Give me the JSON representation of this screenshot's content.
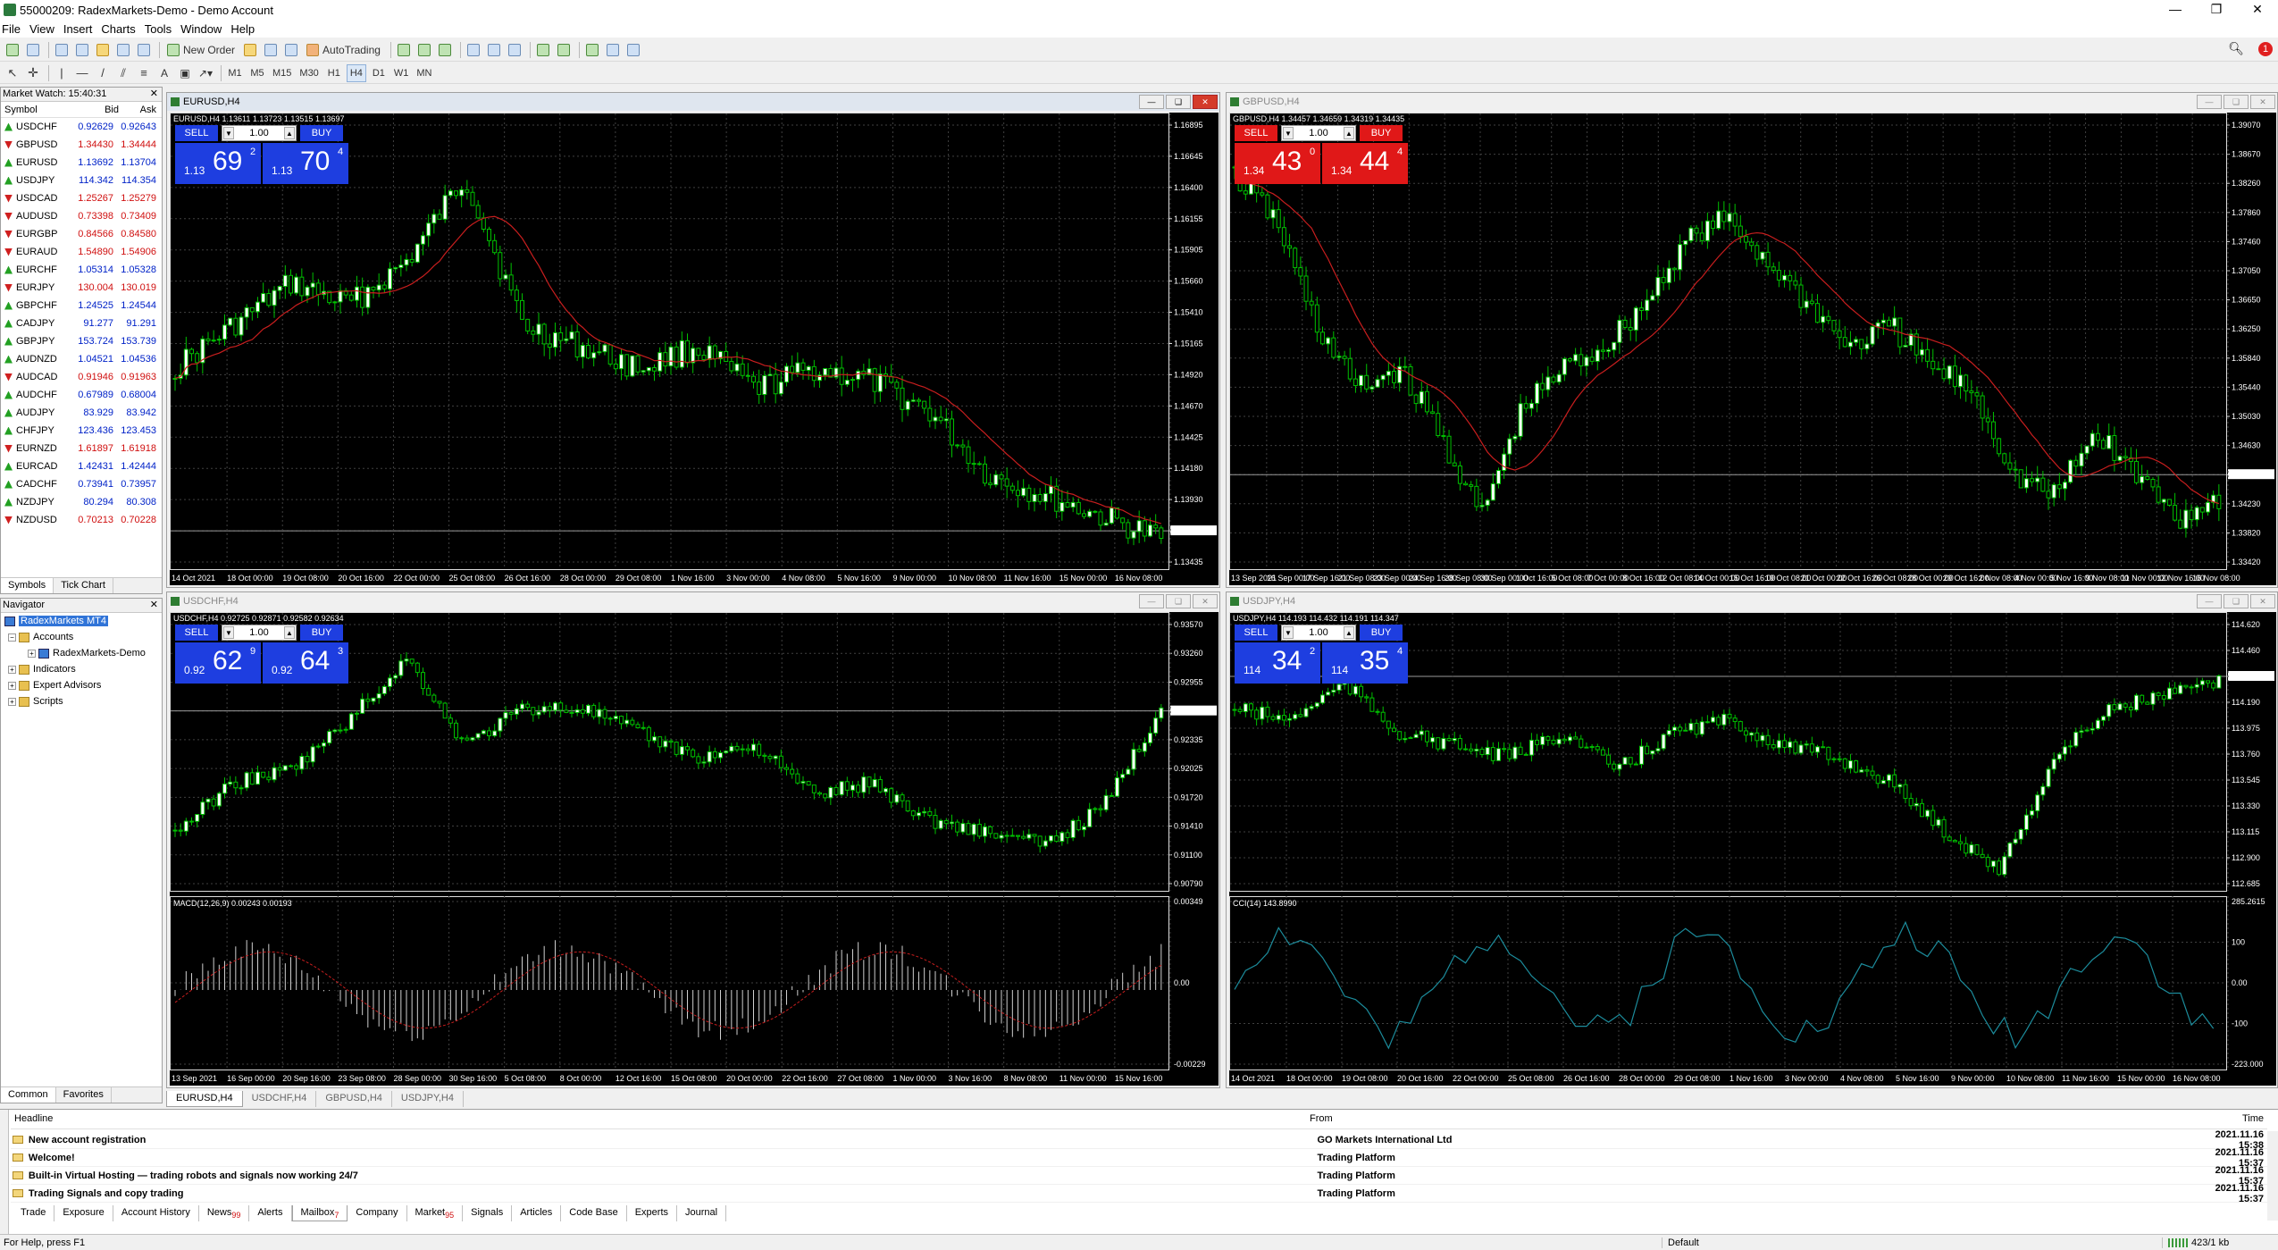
{
  "window": {
    "title": "55000209: RadexMarkets-Demo - Demo Account",
    "controls": [
      "—",
      "❐",
      "✕"
    ]
  },
  "menu": [
    "File",
    "View",
    "Insert",
    "Charts",
    "Tools",
    "Window",
    "Help"
  ],
  "toolbar": {
    "new_order": "New Order",
    "autotrading": "AutoTrading",
    "timeframes": [
      "M1",
      "M5",
      "M15",
      "M30",
      "H1",
      "H4",
      "D1",
      "W1",
      "MN"
    ],
    "active_timeframe": "H4",
    "alert_count": "1"
  },
  "market_watch": {
    "title": "Market Watch: 15:40:31",
    "columns": [
      "Symbol",
      "Bid",
      "Ask"
    ],
    "rows": [
      {
        "symbol": "USDCHF",
        "bid": "0.92629",
        "ask": "0.92643",
        "dir": "up"
      },
      {
        "symbol": "GBPUSD",
        "bid": "1.34430",
        "ask": "1.34444",
        "dir": "dn"
      },
      {
        "symbol": "EURUSD",
        "bid": "1.13692",
        "ask": "1.13704",
        "dir": "up"
      },
      {
        "symbol": "USDJPY",
        "bid": "114.342",
        "ask": "114.354",
        "dir": "up"
      },
      {
        "symbol": "USDCAD",
        "bid": "1.25267",
        "ask": "1.25279",
        "dir": "dn"
      },
      {
        "symbol": "AUDUSD",
        "bid": "0.73398",
        "ask": "0.73409",
        "dir": "dn"
      },
      {
        "symbol": "EURGBP",
        "bid": "0.84566",
        "ask": "0.84580",
        "dir": "dn"
      },
      {
        "symbol": "EURAUD",
        "bid": "1.54890",
        "ask": "1.54906",
        "dir": "dn"
      },
      {
        "symbol": "EURCHF",
        "bid": "1.05314",
        "ask": "1.05328",
        "dir": "up"
      },
      {
        "symbol": "EURJPY",
        "bid": "130.004",
        "ask": "130.019",
        "dir": "dn"
      },
      {
        "symbol": "GBPCHF",
        "bid": "1.24525",
        "ask": "1.24544",
        "dir": "up"
      },
      {
        "symbol": "CADJPY",
        "bid": "91.277",
        "ask": "91.291",
        "dir": "up"
      },
      {
        "symbol": "GBPJPY",
        "bid": "153.724",
        "ask": "153.739",
        "dir": "up"
      },
      {
        "symbol": "AUDNZD",
        "bid": "1.04521",
        "ask": "1.04536",
        "dir": "up"
      },
      {
        "symbol": "AUDCAD",
        "bid": "0.91946",
        "ask": "0.91963",
        "dir": "dn"
      },
      {
        "symbol": "AUDCHF",
        "bid": "0.67989",
        "ask": "0.68004",
        "dir": "up"
      },
      {
        "symbol": "AUDJPY",
        "bid": "83.929",
        "ask": "83.942",
        "dir": "up"
      },
      {
        "symbol": "CHFJPY",
        "bid": "123.436",
        "ask": "123.453",
        "dir": "up"
      },
      {
        "symbol": "EURNZD",
        "bid": "1.61897",
        "ask": "1.61918",
        "dir": "dn"
      },
      {
        "symbol": "EURCAD",
        "bid": "1.42431",
        "ask": "1.42444",
        "dir": "up"
      },
      {
        "symbol": "CADCHF",
        "bid": "0.73941",
        "ask": "0.73957",
        "dir": "up"
      },
      {
        "symbol": "NZDJPY",
        "bid": "80.294",
        "ask": "80.308",
        "dir": "up"
      },
      {
        "symbol": "NZDUSD",
        "bid": "0.70213",
        "ask": "0.70228",
        "dir": "dn"
      }
    ],
    "tabs": [
      "Symbols",
      "Tick Chart"
    ]
  },
  "navigator": {
    "title": "Navigator",
    "root": "RadexMarkets MT4",
    "accounts": "Accounts",
    "account": "RadexMarkets-Demo",
    "indicators": "Indicators",
    "experts": "Expert Advisors",
    "scripts": "Scripts",
    "tabs": [
      "Common",
      "Favorites"
    ]
  },
  "charts": [
    {
      "title": "EURUSD,H4",
      "ohlc": "EURUSD,H4  1.13611 1.13723 1.13515 1.13697",
      "oneclick": {
        "sell": "SELL",
        "buy": "BUY",
        "lot": "1.00",
        "sell_prefix": "1.13",
        "sell_big": "69",
        "sell_sup": "2",
        "buy_prefix": "1.13",
        "buy_big": "70",
        "buy_sup": "4",
        "theme": "blue"
      },
      "price_labels": [
        "1.16895",
        "1.16645",
        "1.16400",
        "1.16155",
        "1.15905",
        "1.15660",
        "1.15410",
        "1.15165",
        "1.14920",
        "1.14670",
        "1.14425",
        "1.14180",
        "1.13930",
        "1.13697",
        "1.13435"
      ],
      "time_labels": [
        "14 Oct 2021",
        "18 Oct 00:00",
        "19 Oct 08:00",
        "20 Oct 16:00",
        "22 Oct 00:00",
        "25 Oct 08:00",
        "26 Oct 16:00",
        "28 Oct 00:00",
        "29 Oct 08:00",
        "1 Nov 16:00",
        "3 Nov 00:00",
        "4 Nov 08:00",
        "5 Nov 16:00",
        "9 Nov 00:00",
        "10 Nov 08:00",
        "11 Nov 16:00",
        "15 Nov 00:00",
        "16 Nov 08:00"
      ],
      "current": "1.13697",
      "indicator": null,
      "active": true
    },
    {
      "title": "GBPUSD,H4",
      "ohlc": "GBPUSD,H4  1.34457 1.34659 1.34319 1.34435",
      "oneclick": {
        "sell": "SELL",
        "buy": "BUY",
        "lot": "1.00",
        "sell_prefix": "1.34",
        "sell_big": "43",
        "sell_sup": "0",
        "buy_prefix": "1.34",
        "buy_big": "44",
        "buy_sup": "4",
        "theme": "red"
      },
      "price_labels": [
        "1.39070",
        "1.38670",
        "1.38260",
        "1.37860",
        "1.37460",
        "1.37050",
        "1.36650",
        "1.36250",
        "1.35840",
        "1.35440",
        "1.35030",
        "1.34630",
        "1.34435",
        "1.34230",
        "1.33820",
        "1.33420"
      ],
      "time_labels": [
        "13 Sep 2021",
        "16 Sep 00:00",
        "17 Sep 16:00",
        "21 Sep 08:00",
        "23 Sep 00:00",
        "24 Sep 16:00",
        "28 Sep 08:00",
        "30 Sep 00:00",
        "1 Oct 16:00",
        "5 Oct 08:00",
        "7 Oct 00:00",
        "8 Oct 16:00",
        "12 Oct 08:00",
        "14 Oct 00:00",
        "15 Oct 16:00",
        "19 Oct 08:00",
        "21 Oct 00:00",
        "22 Oct 16:00",
        "26 Oct 08:00",
        "28 Oct 00:00",
        "29 Oct 16:00",
        "2 Nov 08:00",
        "4 Nov 00:00",
        "5 Nov 16:00",
        "9 Nov 08:00",
        "11 Nov 00:00",
        "12 Nov 16:00",
        "16 Nov 08:00"
      ],
      "current": "1.34435",
      "indicator": null,
      "active": false
    },
    {
      "title": "USDCHF,H4",
      "ohlc": "USDCHF,H4  0.92725 0.92871 0.92582 0.92634",
      "oneclick": {
        "sell": "SELL",
        "buy": "BUY",
        "lot": "1.00",
        "sell_prefix": "0.92",
        "sell_big": "62",
        "sell_sup": "9",
        "buy_prefix": "0.92",
        "buy_big": "64",
        "buy_sup": "3",
        "theme": "blue"
      },
      "price_labels": [
        "0.93570",
        "0.93260",
        "0.92955",
        "0.92634",
        "0.92335",
        "0.92025",
        "0.91720",
        "0.91410",
        "0.91100",
        "0.90790"
      ],
      "time_labels": [
        "13 Sep 2021",
        "16 Sep 00:00",
        "20 Sep 16:00",
        "23 Sep 08:00",
        "28 Sep 00:00",
        "30 Sep 16:00",
        "5 Oct 08:00",
        "8 Oct 00:00",
        "12 Oct 16:00",
        "15 Oct 08:00",
        "20 Oct 00:00",
        "22 Oct 16:00",
        "27 Oct 08:00",
        "1 Nov 00:00",
        "3 Nov 16:00",
        "8 Nov 08:00",
        "11 Nov 00:00",
        "15 Nov 16:00"
      ],
      "current": "0.92634",
      "indicator": {
        "label": "MACD(12,26,9) 0.00243 0.00193",
        "levels": [
          "0.00349",
          "0.00",
          "-0.00229"
        ]
      },
      "active": false
    },
    {
      "title": "USDJPY,H4",
      "ohlc": "USDJPY,H4  114.193 114.432 114.191 114.347",
      "oneclick": {
        "sell": "SELL",
        "buy": "BUY",
        "lot": "1.00",
        "sell_prefix": "114",
        "sell_big": "34",
        "sell_sup": "2",
        "buy_prefix": "114",
        "buy_big": "35",
        "buy_sup": "4",
        "theme": "blue"
      },
      "price_labels": [
        "114.620",
        "114.460",
        "114.347",
        "114.190",
        "113.975",
        "113.760",
        "113.545",
        "113.330",
        "113.115",
        "112.900",
        "112.685"
      ],
      "time_labels": [
        "14 Oct 2021",
        "18 Oct 00:00",
        "19 Oct 08:00",
        "20 Oct 16:00",
        "22 Oct 00:00",
        "25 Oct 08:00",
        "26 Oct 16:00",
        "28 Oct 00:00",
        "29 Oct 08:00",
        "1 Nov 16:00",
        "3 Nov 00:00",
        "4 Nov 08:00",
        "5 Nov 16:00",
        "9 Nov 00:00",
        "10 Nov 08:00",
        "11 Nov 16:00",
        "15 Nov 00:00",
        "16 Nov 08:00"
      ],
      "current": "114.347",
      "indicator": {
        "label": "CCI(14) 143.8990",
        "levels": [
          "285.2615",
          "100",
          "0.00",
          "-100",
          "-223.000"
        ]
      },
      "active": false
    }
  ],
  "chart_tabs": [
    "EURUSD,H4",
    "USDCHF,H4",
    "GBPUSD,H4",
    "USDJPY,H4"
  ],
  "terminal": {
    "side_label": "Terminal",
    "columns": [
      "Headline",
      "From",
      "Time"
    ],
    "messages": [
      {
        "headline": "New account registration",
        "from": "GO Markets International Ltd",
        "time": "2021.11.16 15:38"
      },
      {
        "headline": "Welcome!",
        "from": "Trading Platform",
        "time": "2021.11.16 15:37"
      },
      {
        "headline": "Built-in Virtual Hosting — trading robots and signals now working 24/7",
        "from": "Trading Platform",
        "time": "2021.11.16 15:37"
      },
      {
        "headline": "Trading Signals and copy trading",
        "from": "Trading Platform",
        "time": "2021.11.16 15:37"
      }
    ],
    "tabs": [
      {
        "label": "Trade",
        "count": ""
      },
      {
        "label": "Exposure",
        "count": ""
      },
      {
        "label": "Account History",
        "count": ""
      },
      {
        "label": "News",
        "count": "99"
      },
      {
        "label": "Alerts",
        "count": ""
      },
      {
        "label": "Mailbox",
        "count": "7"
      },
      {
        "label": "Company",
        "count": ""
      },
      {
        "label": "Market",
        "count": "95"
      },
      {
        "label": "Signals",
        "count": ""
      },
      {
        "label": "Articles",
        "count": ""
      },
      {
        "label": "Code Base",
        "count": ""
      },
      {
        "label": "Experts",
        "count": ""
      },
      {
        "label": "Journal",
        "count": ""
      }
    ],
    "active_tab": "Mailbox"
  },
  "status": {
    "help": "For Help, press F1",
    "profile": "Default",
    "connection": "423/1 kb"
  },
  "colors": {
    "bull": "#00c000",
    "bear": "#ffffff",
    "grid": "#404040",
    "ma": "#c81e1e",
    "macd_signal": "#c81e1e",
    "cci": "#1c8c9c"
  }
}
